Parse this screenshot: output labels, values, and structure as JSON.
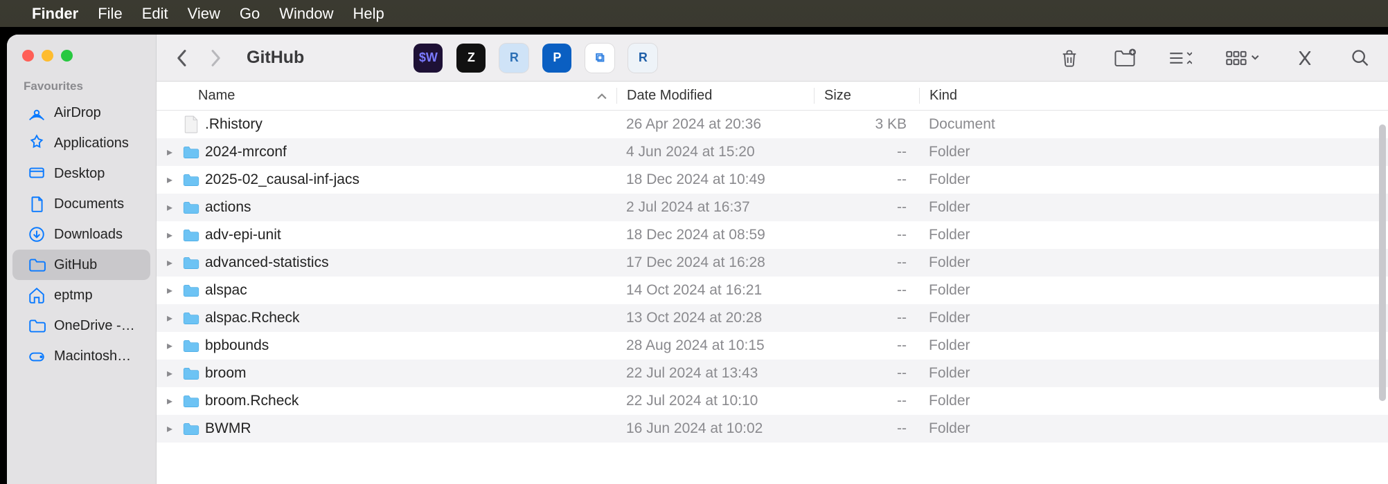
{
  "menubar": {
    "app": "Finder",
    "items": [
      "File",
      "Edit",
      "View",
      "Go",
      "Window",
      "Help"
    ]
  },
  "window": {
    "title": "GitHub"
  },
  "sidebar": {
    "section": "Favourites",
    "items": [
      {
        "icon": "airdrop",
        "label": "AirDrop"
      },
      {
        "icon": "apps",
        "label": "Applications"
      },
      {
        "icon": "desktop",
        "label": "Desktop"
      },
      {
        "icon": "doc",
        "label": "Documents"
      },
      {
        "icon": "down",
        "label": "Downloads"
      },
      {
        "icon": "folder",
        "label": "GitHub",
        "selected": true
      },
      {
        "icon": "home",
        "label": "eptmp"
      },
      {
        "icon": "folder",
        "label": "OneDrive -…"
      },
      {
        "icon": "disk",
        "label": "Macintosh…"
      }
    ]
  },
  "toolbar_apps": [
    {
      "bg": "#1e1136",
      "fg": "#7a7aff",
      "text": "$W"
    },
    {
      "bg": "#111",
      "fg": "#fff",
      "text": "Z"
    },
    {
      "bg": "#cfe3f7",
      "fg": "#2b6fb5",
      "text": "R"
    },
    {
      "bg": "#0a5fc2",
      "fg": "#fff",
      "text": "P"
    },
    {
      "bg": "#fff",
      "fg": "#2b7de0",
      "text": "⧉"
    },
    {
      "bg": "#eef3f8",
      "fg": "#1f5fa8",
      "text": "R"
    }
  ],
  "columns": {
    "name": "Name",
    "date": "Date Modified",
    "size": "Size",
    "kind": "Kind"
  },
  "rows": [
    {
      "type": "file",
      "name": ".Rhistory",
      "date": "26 Apr 2024 at 20:36",
      "size": "3 KB",
      "kind": "Document"
    },
    {
      "type": "folder",
      "name": "2024-mrconf",
      "date": "4 Jun 2024 at 15:20",
      "size": "--",
      "kind": "Folder"
    },
    {
      "type": "folder",
      "name": "2025-02_causal-inf-jacs",
      "date": "18 Dec 2024 at 10:49",
      "size": "--",
      "kind": "Folder"
    },
    {
      "type": "folder",
      "name": "actions",
      "date": "2 Jul 2024 at 16:37",
      "size": "--",
      "kind": "Folder"
    },
    {
      "type": "folder",
      "name": "adv-epi-unit",
      "date": "18 Dec 2024 at 08:59",
      "size": "--",
      "kind": "Folder"
    },
    {
      "type": "folder",
      "name": "advanced-statistics",
      "date": "17 Dec 2024 at 16:28",
      "size": "--",
      "kind": "Folder"
    },
    {
      "type": "folder",
      "name": "alspac",
      "date": "14 Oct 2024 at 16:21",
      "size": "--",
      "kind": "Folder"
    },
    {
      "type": "folder",
      "name": "alspac.Rcheck",
      "date": "13 Oct 2024 at 20:28",
      "size": "--",
      "kind": "Folder"
    },
    {
      "type": "folder",
      "name": "bpbounds",
      "date": "28 Aug 2024 at 10:15",
      "size": "--",
      "kind": "Folder"
    },
    {
      "type": "folder",
      "name": "broom",
      "date": "22 Jul 2024 at 13:43",
      "size": "--",
      "kind": "Folder"
    },
    {
      "type": "folder",
      "name": "broom.Rcheck",
      "date": "22 Jul 2024 at 10:10",
      "size": "--",
      "kind": "Folder"
    },
    {
      "type": "folder",
      "name": "BWMR",
      "date": "16 Jun 2024 at 10:02",
      "size": "--",
      "kind": "Folder"
    }
  ]
}
